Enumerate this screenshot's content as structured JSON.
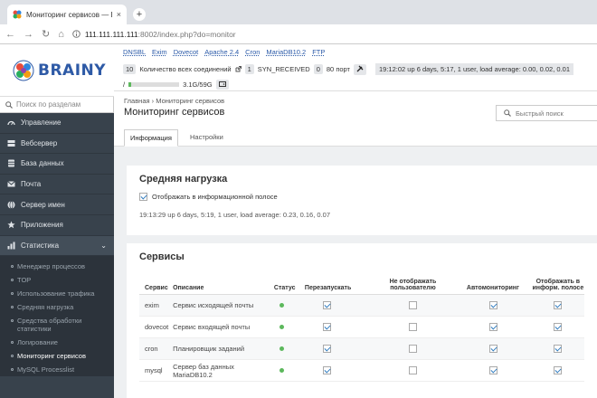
{
  "browser": {
    "tab_title": "Мониторинг сервисов — Brainy",
    "url_host": "111.111.111.111",
    "url_path": ":8002/index.php?do=monitor",
    "close": "×",
    "new_tab": "+",
    "back": "←",
    "forward": "→",
    "reload": "↻",
    "home": "⌂"
  },
  "brand": {
    "name": "BRAINY"
  },
  "sidebar": {
    "search_placeholder": "Поиск по разделам",
    "items": [
      {
        "label": "Управление",
        "icon": "gauge-icon"
      },
      {
        "label": "Вебсервер",
        "icon": "server-icon"
      },
      {
        "label": "База данных",
        "icon": "database-icon"
      },
      {
        "label": "Почта",
        "icon": "mail-icon"
      },
      {
        "label": "Сервер имен",
        "icon": "globe-icon"
      },
      {
        "label": "Приложения",
        "icon": "star-icon"
      },
      {
        "label": "Статистика",
        "icon": "chart-icon",
        "chevron": "⌄"
      }
    ],
    "sub": [
      "Менеджер процессов",
      "TOP",
      "Использование трафика",
      "Средняя нагрузка",
      "Средства обработки статистики",
      "Логирование",
      "Мониторинг сервисов",
      "MySQL Processlist"
    ]
  },
  "topinfo": {
    "links": [
      "DNSBL",
      "Exim",
      "Dovecot",
      "Apache 2.4",
      "Cron",
      "MariaDB10.2",
      "FTP"
    ],
    "conn_count": "10",
    "conn_label": "Количество всех соединений",
    "syn_count": "1",
    "syn_label": "SYN_RECEIVED",
    "port_count": "0",
    "port_label": "80 порт",
    "uptime": "19:12:02 up 6 days, 5:17, 1 user, load average: 0.00, 0.02, 0.01",
    "disk_prefix": "/",
    "disk": "3.1G/59G",
    "disk_fraction": 0.05
  },
  "page": {
    "crumb_home": "Главная",
    "crumb_sep": "›",
    "crumb_current": "Мониторинг сервисов",
    "title": "Мониторинг сервисов",
    "search_placeholder": "Быстрый поиск"
  },
  "tabs": [
    "Информация",
    "Настройки"
  ],
  "load": {
    "title": "Средняя нагрузка",
    "checkbox_label": "Отображать в информационной полосе",
    "value": "19:13:29 up 6 days, 5:19, 1 user, load average: 0.23, 0.16, 0.07"
  },
  "services": {
    "title": "Сервисы",
    "columns": [
      "Сервис",
      "Описание",
      "Статус",
      "Перезапускать",
      "Не отображать пользователю",
      "Автомониторинг",
      "Отображать в информ. полосе"
    ],
    "rows": [
      {
        "name": "exim",
        "desc": "Сервис исходящей почты",
        "restart": true,
        "hide": false,
        "auto": true,
        "bar": true
      },
      {
        "name": "dovecot",
        "desc": "Сервис входящей почты",
        "restart": true,
        "hide": false,
        "auto": true,
        "bar": true
      },
      {
        "name": "cron",
        "desc": "Планировщик заданий",
        "restart": true,
        "hide": false,
        "auto": true,
        "bar": true
      },
      {
        "name": "mysql",
        "desc": "Сервер баз данных MariaDB10.2",
        "restart": true,
        "hide": false,
        "auto": true,
        "bar": true
      }
    ]
  },
  "colors": {
    "accent": "#2b5aa8",
    "status_ok": "#5cb85c",
    "sidebar": "#38424c"
  }
}
